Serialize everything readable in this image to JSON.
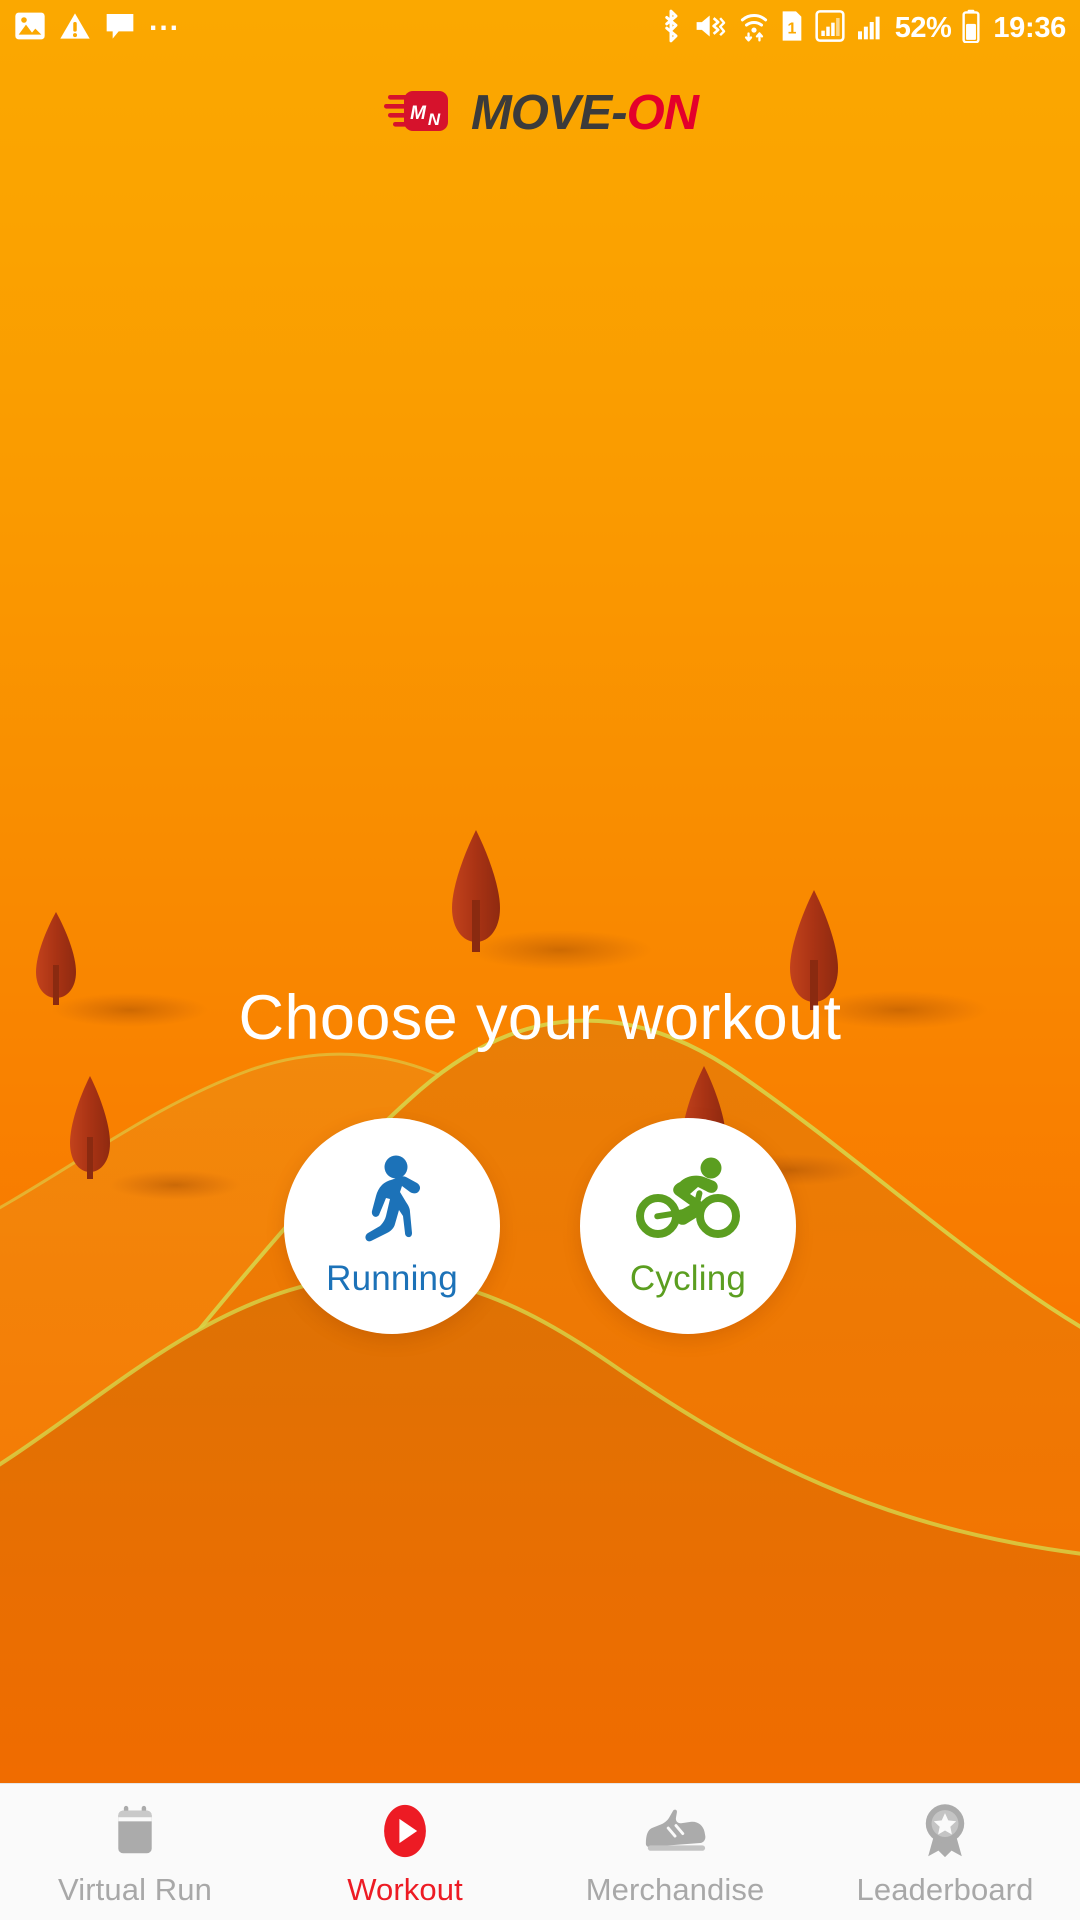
{
  "status_bar": {
    "left_icons": [
      {
        "name": "image-icon",
        "glyph": "image"
      },
      {
        "name": "warning-icon",
        "glyph": "warning"
      },
      {
        "name": "message-icon",
        "glyph": "message"
      },
      {
        "name": "more-icon",
        "glyph": "..."
      }
    ],
    "right_icons": [
      {
        "name": "bluetooth-icon"
      },
      {
        "name": "mute-vibrate-icon"
      },
      {
        "name": "wifi-data-icon"
      },
      {
        "name": "sim-1-icon",
        "label": "1"
      },
      {
        "name": "signal-boxed-icon"
      },
      {
        "name": "signal-icon"
      }
    ],
    "battery_percent": "52%",
    "time": "19:36"
  },
  "header": {
    "logo_name": "move-on-logo",
    "logo_mark_letters": "MN",
    "brand_part1": "MOVE",
    "brand_dash": "-",
    "brand_part2": "ON"
  },
  "main": {
    "heading": "Choose your workout",
    "choices": [
      {
        "id": "running",
        "label": "Running",
        "icon": "runner-icon",
        "color": "#1C72B8"
      },
      {
        "id": "cycling",
        "label": "Cycling",
        "icon": "cyclist-icon",
        "color": "#5B9E20"
      }
    ]
  },
  "tabbar": {
    "items": [
      {
        "id": "virtual-run",
        "label": "Virtual Run",
        "icon": "calendar-icon",
        "active": false
      },
      {
        "id": "workout",
        "label": "Workout",
        "icon": "play-icon",
        "active": true
      },
      {
        "id": "merchandise",
        "label": "Merchandise",
        "icon": "shoe-icon",
        "active": false
      },
      {
        "id": "leaderboard",
        "label": "Leaderboard",
        "icon": "medal-star-icon",
        "active": false
      }
    ]
  },
  "colors": {
    "bg_top": "#FBA800",
    "bg_bottom": "#F76A00",
    "accent_red": "#ED1B24",
    "brand_red": "#E4002B",
    "running_blue": "#1C72B8",
    "cycling_green": "#5B9E20",
    "tab_inactive": "#A8A8A8",
    "tabbar_bg": "#FAFAFA",
    "hill_light": "#ED8A10",
    "hill_dark": "#E07B08",
    "hill_outline": "#D8D84A",
    "tree": "#B5391A"
  }
}
